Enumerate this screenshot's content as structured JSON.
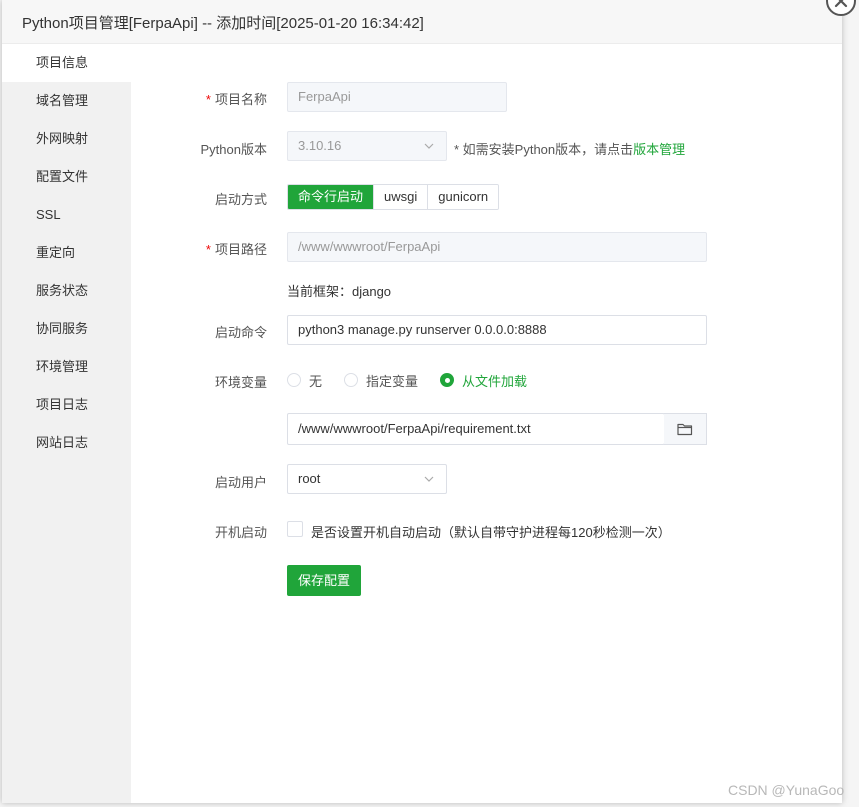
{
  "dialog": {
    "title": "Python项目管理[FerpaApi] -- 添加时间[2025-01-20 16:34:42]"
  },
  "sidebar": {
    "items": [
      {
        "label": "项目信息"
      },
      {
        "label": "域名管理"
      },
      {
        "label": "外网映射"
      },
      {
        "label": "配置文件"
      },
      {
        "label": "SSL"
      },
      {
        "label": "重定向"
      },
      {
        "label": "服务状态"
      },
      {
        "label": "协同服务"
      },
      {
        "label": "环境管理"
      },
      {
        "label": "项目日志"
      },
      {
        "label": "网站日志"
      }
    ],
    "active_index": 0
  },
  "form": {
    "project_name": {
      "required_mark": "*",
      "label": "项目名称",
      "value": "FerpaApi"
    },
    "python_version": {
      "label": "Python版本",
      "value": "3.10.16",
      "hint_prefix": "* 如需安装Python版本，请点击",
      "hint_link": "版本管理"
    },
    "start_method": {
      "label": "启动方式",
      "options": [
        "命令行启动",
        "uwsgi",
        "gunicorn"
      ],
      "selected_index": 0
    },
    "project_path": {
      "required_mark": "*",
      "label": "项目路径",
      "value": "/www/wwwroot/FerpaApi",
      "framework_text": "当前框架：django"
    },
    "start_command": {
      "label": "启动命令",
      "value": "python3 manage.py runserver 0.0.0.0:8888"
    },
    "env_vars": {
      "label": "环境变量",
      "options": [
        "无",
        "指定变量",
        "从文件加载"
      ],
      "selected_index": 2,
      "file_path": "/www/wwwroot/FerpaApi/requirement.txt"
    },
    "start_user": {
      "label": "启动用户",
      "value": "root"
    },
    "autostart": {
      "label": "开机启动",
      "checkbox_label": "是否设置开机自动启动（默认自带守护进程每120秒检测一次）",
      "checked": false
    },
    "save_label": "保存配置"
  },
  "watermark": "CSDN @YunaGoo",
  "colors": {
    "accent": "#20a53a",
    "required": "#ef0808",
    "sidebar_bg": "#f1f1f1"
  },
  "icons": {
    "close": "close-icon",
    "folder": "folder-icon",
    "select_arrow": "chevron-down-icon"
  }
}
